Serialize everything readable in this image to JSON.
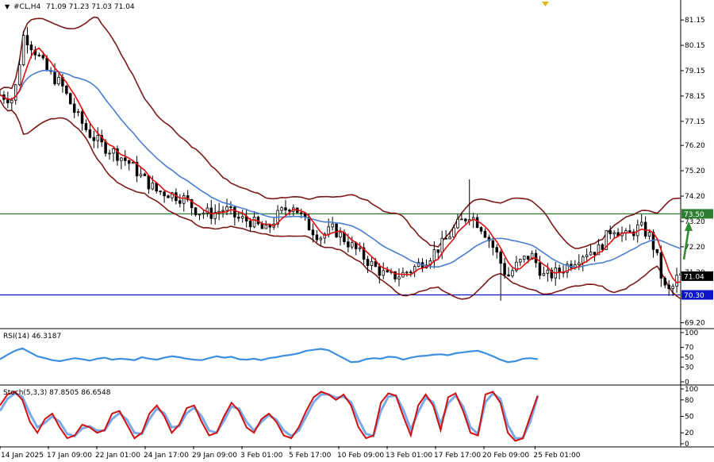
{
  "header": {
    "symbol": "#CL,H4",
    "ohlc": "71.09 71.23 71.03 71.04"
  },
  "colors": {
    "background": "#ffffff",
    "candle": "#000000",
    "bollinger": "#7b1a1a",
    "ma_fast": "#e01010",
    "ma_slow": "#4a7fd0",
    "resistance": "#2e7d32",
    "support": "#0a14c8",
    "rsi": "#3d8fe0",
    "stoch_main": "#d01010",
    "stoch_signal": "#7aaae8",
    "arrow": "#2e8b2e"
  },
  "chart_data": [
    {
      "type": "candlestick",
      "symbol": "#CL",
      "timeframe": "H4",
      "ylim": [
        69.0,
        81.5
      ],
      "y_ticks": [
        "81.15",
        "80.15",
        "79.15",
        "78.15",
        "77.15",
        "76.20",
        "75.20",
        "74.20",
        "73.20",
        "72.20",
        "71.20",
        "69.20"
      ],
      "x_tick_labels": [
        "14 Jan 2025",
        "17 Jan 09:00",
        "22 Jan 01:00",
        "24 Jan 17:00",
        "29 Jan 09:00",
        "3 Feb 01:00",
        "5 Feb 17:00",
        "10 Feb 09:00",
        "13 Feb 01:00",
        "17 Feb 17:00",
        "20 Feb 09:00",
        "25 Feb 01:00"
      ],
      "x_tick_positions": [
        0,
        0.09,
        0.18,
        0.27,
        0.36,
        0.45,
        0.54,
        0.63,
        0.72,
        0.81,
        0.9,
        0.995
      ],
      "price_path": [
        [
          0,
          78.2
        ],
        [
          0.02,
          78.0
        ],
        [
          0.035,
          80.6
        ],
        [
          0.05,
          80.0
        ],
        [
          0.07,
          79.1
        ],
        [
          0.09,
          78.6
        ],
        [
          0.11,
          77.5
        ],
        [
          0.13,
          76.7
        ],
        [
          0.15,
          76.2
        ],
        [
          0.17,
          75.9
        ],
        [
          0.19,
          75.5
        ],
        [
          0.21,
          74.9
        ],
        [
          0.23,
          74.4
        ],
        [
          0.25,
          74.3
        ],
        [
          0.27,
          74.1
        ],
        [
          0.29,
          73.6
        ],
        [
          0.31,
          73.5
        ],
        [
          0.33,
          73.7
        ],
        [
          0.35,
          73.3
        ],
        [
          0.37,
          73.2
        ],
        [
          0.39,
          72.8
        ],
        [
          0.41,
          73.5
        ],
        [
          0.43,
          73.9
        ],
        [
          0.45,
          73.1
        ],
        [
          0.47,
          72.6
        ],
        [
          0.49,
          72.9
        ],
        [
          0.51,
          72.4
        ],
        [
          0.53,
          71.9
        ],
        [
          0.55,
          71.4
        ],
        [
          0.57,
          71.0
        ],
        [
          0.59,
          71.1
        ],
        [
          0.61,
          71.4
        ],
        [
          0.63,
          71.8
        ],
        [
          0.65,
          72.3
        ],
        [
          0.67,
          73.0
        ],
        [
          0.69,
          73.5
        ],
        [
          0.71,
          72.9
        ],
        [
          0.73,
          71.9
        ],
        [
          0.745,
          71.0
        ],
        [
          0.76,
          71.5
        ],
        [
          0.78,
          71.9
        ],
        [
          0.8,
          71.0
        ],
        [
          0.82,
          71.2
        ],
        [
          0.84,
          71.6
        ],
        [
          0.86,
          72.0
        ],
        [
          0.88,
          72.1
        ],
        [
          0.9,
          73.0
        ],
        [
          0.92,
          72.6
        ],
        [
          0.94,
          73.0
        ],
        [
          0.955,
          72.6
        ],
        [
          0.965,
          71.8
        ],
        [
          0.975,
          70.6
        ],
        [
          0.985,
          70.4
        ],
        [
          0.995,
          71.0
        ],
        [
          1.0,
          71.04
        ]
      ],
      "price_tags": [
        {
          "label": "73.50",
          "value": 73.5,
          "color": "#2e7d32"
        },
        {
          "label": "71.04",
          "value": 71.04,
          "color": "#000000"
        },
        {
          "label": "70.30",
          "value": 70.3,
          "color": "#0a14c8"
        }
      ],
      "hlines": [
        {
          "value": 73.5,
          "color": "#2e7d32"
        },
        {
          "value": 70.3,
          "color": "#0a14c8"
        }
      ],
      "projection_arrow": {
        "from": 71.7,
        "to": 73.2
      }
    },
    {
      "type": "line",
      "indicator": "RSI(14)",
      "label": "RSI(14) 46.3187",
      "ylim": [
        0,
        100
      ],
      "y_ticks": [
        "100",
        "70",
        "50",
        "30",
        "0"
      ],
      "values": [
        46,
        55,
        63,
        68,
        60,
        52,
        48,
        44,
        42,
        45,
        48,
        46,
        43,
        47,
        49,
        45,
        47,
        46,
        44,
        50,
        47,
        45,
        49,
        52,
        50,
        47,
        45,
        44,
        48,
        52,
        49,
        51,
        46,
        45,
        47,
        44,
        48,
        50,
        53,
        55,
        58,
        63,
        65,
        67,
        64,
        56,
        48,
        40,
        41,
        46,
        48,
        47,
        51,
        50,
        45,
        49,
        52,
        53,
        55,
        56,
        54,
        58,
        60,
        62,
        63,
        58,
        52,
        45,
        40,
        42,
        47,
        48,
        46
      ]
    },
    {
      "type": "line",
      "indicator": "Stoch(5,3,3)",
      "label": "Stoch(5,3,3) 87.8505 86.6548",
      "ylim": [
        0,
        100
      ],
      "y_ticks": [
        "100",
        "80",
        "50",
        "20",
        "0"
      ],
      "series": [
        {
          "values": [
            70,
            90,
            95,
            80,
            40,
            20,
            45,
            55,
            30,
            10,
            15,
            35,
            30,
            20,
            25,
            55,
            60,
            35,
            10,
            20,
            55,
            70,
            50,
            20,
            35,
            65,
            70,
            40,
            15,
            20,
            50,
            75,
            60,
            30,
            20,
            45,
            55,
            40,
            15,
            10,
            30,
            60,
            85,
            95,
            90,
            80,
            90,
            70,
            30,
            10,
            15,
            75,
            92,
            88,
            50,
            15,
            70,
            90,
            70,
            25,
            85,
            92,
            60,
            20,
            15,
            90,
            95,
            75,
            20,
            5,
            10,
            50,
            88
          ]
        },
        {
          "values": [
            60,
            82,
            92,
            86,
            55,
            30,
            38,
            50,
            40,
            18,
            14,
            28,
            32,
            24,
            24,
            45,
            56,
            44,
            20,
            18,
            45,
            64,
            56,
            30,
            32,
            56,
            66,
            50,
            24,
            20,
            42,
            68,
            64,
            40,
            24,
            40,
            52,
            44,
            24,
            14,
            24,
            50,
            76,
            90,
            90,
            84,
            86,
            76,
            44,
            18,
            14,
            60,
            86,
            88,
            62,
            26,
            58,
            84,
            76,
            36,
            74,
            88,
            68,
            30,
            18,
            76,
            92,
            82,
            34,
            10,
            10,
            40,
            87
          ]
        }
      ]
    }
  ]
}
